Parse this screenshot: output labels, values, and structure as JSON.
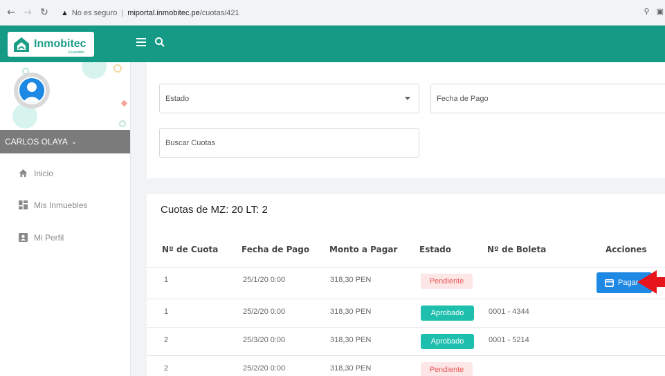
{
  "browser": {
    "security_label": "No es seguro",
    "url_host": "miportal.inmobitec.pe",
    "url_path": "/cuotas/421",
    "back_icon": "arrow-left-icon",
    "forward_icon": "arrow-right-icon",
    "reload_icon": "reload-icon"
  },
  "app": {
    "brand": "Inmobitec",
    "tagline": "Es posible",
    "accent": "#149a85"
  },
  "sidebar": {
    "user_name": "CARLOS OLAYA",
    "items": [
      {
        "label": "Inicio",
        "icon": "home-icon"
      },
      {
        "label": "Mis Inmuebles",
        "icon": "grid-icon"
      },
      {
        "label": "Mi Perfil",
        "icon": "user-card-icon"
      }
    ]
  },
  "filters": {
    "estado_label": "Estado",
    "fecha_label": "Fecha de Pago",
    "buscar_label": "Buscar Cuotas"
  },
  "table": {
    "title": "Cuotas de MZ: 20 LT: 2",
    "headers": [
      "Nº de Cuota",
      "Fecha de Pago",
      "Monto a Pagar",
      "Estado",
      "Nº de Boleta",
      "Acciones"
    ],
    "rows": [
      {
        "cuota": "1",
        "fecha": "25/1/20 0:00",
        "monto": "318,30 PEN",
        "estado": "Pendiente",
        "boleta": "",
        "accion": "Pagar"
      },
      {
        "cuota": "1",
        "fecha": "25/2/20 0:00",
        "monto": "318,30 PEN",
        "estado": "Aprobado",
        "boleta": "0001 - 4344",
        "accion": ""
      },
      {
        "cuota": "2",
        "fecha": "25/3/20 0:00",
        "monto": "318,30 PEN",
        "estado": "Aprobado",
        "boleta": "0001 - 5214",
        "accion": ""
      },
      {
        "cuota": "2",
        "fecha": "25/2/20 0:00",
        "monto": "318,30 PEN",
        "estado": "Pendiente",
        "boleta": "",
        "accion": ""
      }
    ]
  },
  "colors": {
    "pending_bg": "#fde6e6",
    "pending_text": "#e85a5a",
    "approved_bg": "#1fbfae",
    "pay_button": "#1e88e5",
    "annotation_arrow": "#e8141c"
  }
}
